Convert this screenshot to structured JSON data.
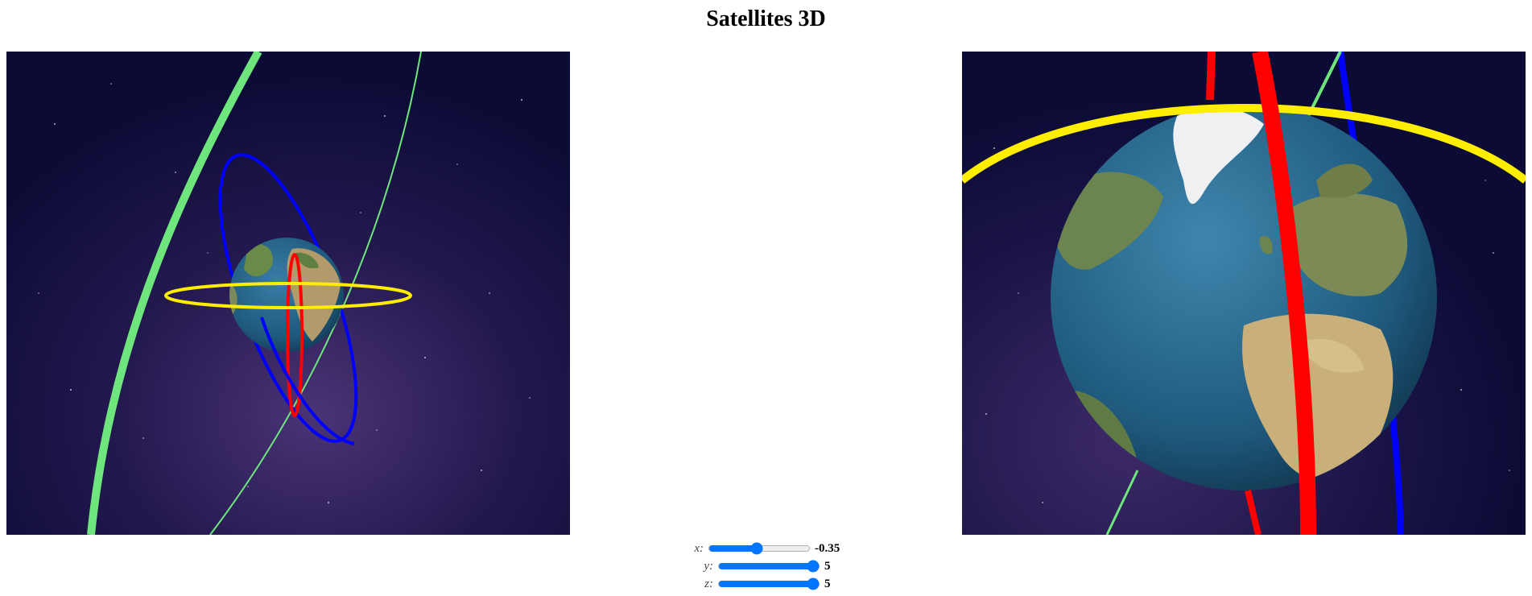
{
  "page": {
    "title": "Satellites 3D"
  },
  "views": {
    "left": {
      "scene": "earth-with-orbits-far"
    },
    "right": {
      "scene": "earth-with-orbits-close"
    }
  },
  "orbits": [
    {
      "name": "green",
      "color": "#6ee67d"
    },
    {
      "name": "blue",
      "color": "#0000ff"
    },
    {
      "name": "red",
      "color": "#ff0000"
    },
    {
      "name": "yellow",
      "color": "#ffee00"
    }
  ],
  "controls": {
    "x": {
      "label": "x:",
      "value": "-0.35",
      "fraction": 0.47
    },
    "y": {
      "label": "y:",
      "value": "5",
      "fraction": 1.0
    },
    "z": {
      "label": "z:",
      "value": "5",
      "fraction": 1.0
    }
  },
  "colors": {
    "slider_accent": "#0075ff",
    "space_background": "#0c0c3a"
  }
}
